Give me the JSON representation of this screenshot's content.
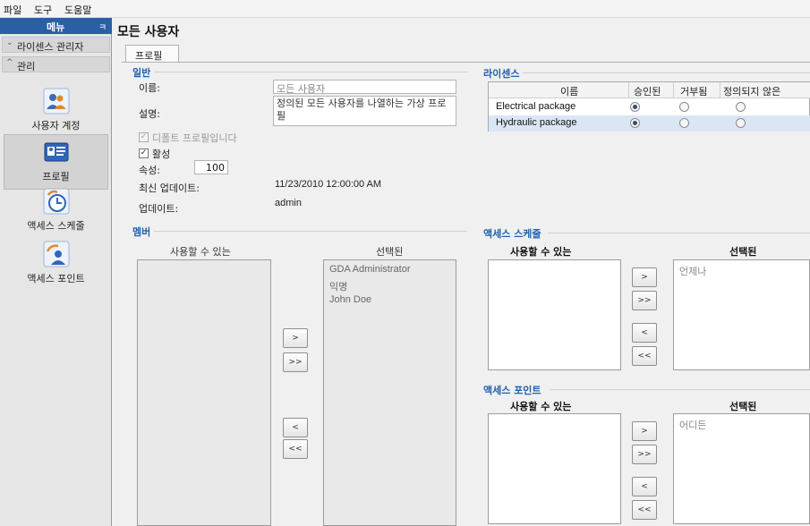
{
  "menubar": {
    "file": "파일",
    "tools": "도구",
    "help": "도움말"
  },
  "sidebar": {
    "header": "메뉴",
    "pin": "ㅋ",
    "groups": [
      {
        "label": "라이센스 관리자",
        "chevron": "⌄"
      },
      {
        "label": "관리",
        "chevron": "^"
      }
    ],
    "items": [
      {
        "label": "사용자 계정",
        "icon": "users-icon"
      },
      {
        "label": "프로필",
        "icon": "profile-card-icon"
      },
      {
        "label": "액세스 스케줄",
        "icon": "schedule-clock-icon"
      },
      {
        "label": "액세스 포인트",
        "icon": "access-point-icon"
      }
    ]
  },
  "page": {
    "title": "모든 사용자",
    "tab": "프로필"
  },
  "general": {
    "title": "일반",
    "name_label": "이름:",
    "name_value": "모든 사용자",
    "desc_label": "설명:",
    "desc_value": "정의된 모든 사용자를 나열하는 가상 프로필",
    "default_label": "디폴트 프로필입니다",
    "active_label": "활성",
    "attr_label": "속성:",
    "attr_value": "100",
    "updated_label": "최신 업데이트:",
    "updated_value": "11/23/2010 12:00:00 AM",
    "updater_label": "업데이트:",
    "updater_value": "admin"
  },
  "license": {
    "title": "라이센스",
    "headers": [
      "이름",
      "승인된",
      "거부됨",
      "정의되지 않은"
    ],
    "rows": [
      {
        "name": "Electrical package",
        "selected": "approved"
      },
      {
        "name": "Hydraulic package",
        "selected": "approved"
      }
    ]
  },
  "members": {
    "title": "멤버",
    "available_header": "사용할 수 있는",
    "selected_header": "선택된",
    "available": [],
    "selected": [
      "GDA Administrator",
      "익명",
      "John Doe"
    ],
    "buttons": [
      ">",
      ">>",
      "<",
      "<<"
    ]
  },
  "schedule": {
    "title": "액세스 스케줄",
    "available_header": "사용할 수 있는",
    "selected_header": "선택된",
    "selected": [
      "언제나"
    ],
    "buttons": [
      ">",
      ">>",
      "<",
      "<<"
    ]
  },
  "access_point": {
    "title": "액세스 포인트",
    "available_header": "사용할 수 있는",
    "selected_header": "선택된",
    "selected": [
      "어디든"
    ],
    "buttons": [
      ">",
      ">>",
      "<",
      "<<"
    ]
  },
  "colors": {
    "accent": "#1f5fb0",
    "sidebar_header": "#2a5ea7"
  }
}
